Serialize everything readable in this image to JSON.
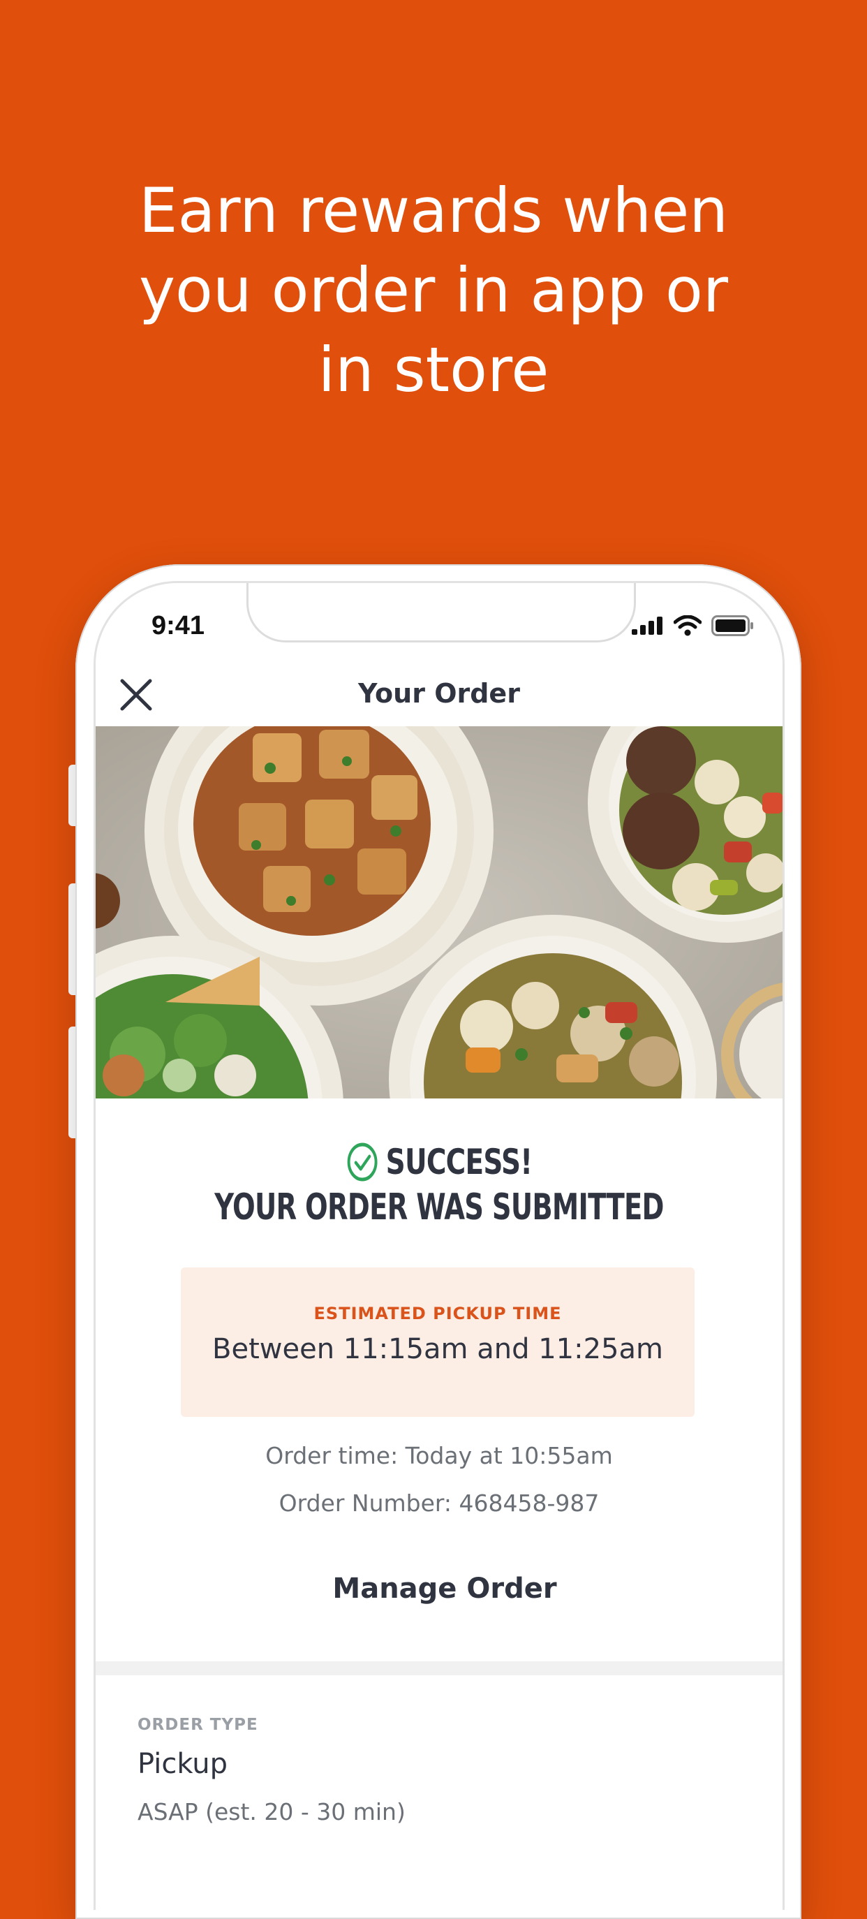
{
  "promo": {
    "headline_line1": "Earn rewards when",
    "headline_line2": "you order in app or",
    "headline_line3": "in store"
  },
  "status_bar": {
    "time": "9:41",
    "icons": [
      "cellular-signal-icon",
      "wifi-icon",
      "battery-icon"
    ]
  },
  "nav": {
    "title": "Your Order",
    "close_icon": "close-icon"
  },
  "confirmation": {
    "success_label": "SUCCESS!",
    "submitted_label": "YOUR ORDER WAS SUBMITTED",
    "check_icon": "check-circle-icon"
  },
  "pickup": {
    "label": "ESTIMATED PICKUP TIME",
    "value": "Between 11:15am and 11:25am"
  },
  "order": {
    "time_text": "Order time: Today at 10:55am",
    "number_text": "Order Number: 468458-987",
    "manage_label": "Manage Order"
  },
  "order_type": {
    "label": "ORDER TYPE",
    "value": "Pickup",
    "detail": "ASAP (est. 20 - 30 min)"
  },
  "colors": {
    "brand_orange": "#E04F0B",
    "success_green": "#2EA55B",
    "pickup_bg": "#FCEDE5",
    "pickup_label": "#D9531A",
    "text_dark": "#2F3440"
  }
}
